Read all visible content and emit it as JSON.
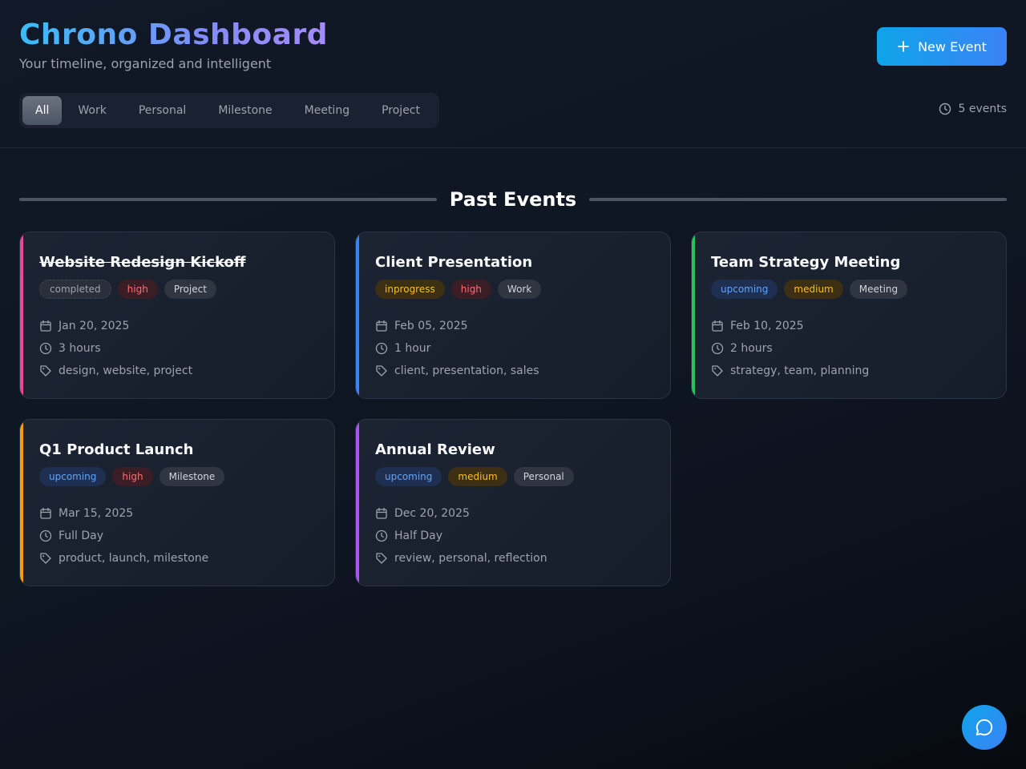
{
  "header": {
    "title": "Chrono Dashboard",
    "subtitle": "Your timeline, organized and intelligent",
    "new_event_label": "New Event",
    "event_count": "5 events"
  },
  "filters": [
    "All",
    "Work",
    "Personal",
    "Milestone",
    "Meeting",
    "Project"
  ],
  "active_filter": "All",
  "section": {
    "title": "Past Events"
  },
  "events": [
    {
      "title": "Website Redesign Kickoff",
      "status": "completed",
      "priority": "high",
      "category": "Project",
      "date": "Jan 20, 2025",
      "duration": "3 hours",
      "tags": "design, website, project",
      "accent": "#ec4899"
    },
    {
      "title": "Client Presentation",
      "status": "inprogress",
      "priority": "high",
      "category": "Work",
      "date": "Feb 05, 2025",
      "duration": "1 hour",
      "tags": "client, presentation, sales",
      "accent": "#3b82f6"
    },
    {
      "title": "Team Strategy Meeting",
      "status": "upcoming",
      "priority": "medium",
      "category": "Meeting",
      "date": "Feb 10, 2025",
      "duration": "2 hours",
      "tags": "strategy, team, planning",
      "accent": "#22c55e"
    },
    {
      "title": "Q1 Product Launch",
      "status": "upcoming",
      "priority": "high",
      "category": "Milestone",
      "date": "Mar 15, 2025",
      "duration": "Full Day",
      "tags": "product, launch, milestone",
      "accent": "#f59e0b"
    },
    {
      "title": "Annual Review",
      "status": "upcoming",
      "priority": "medium",
      "category": "Personal",
      "date": "Dec 20, 2025",
      "duration": "Half Day",
      "tags": "review, personal, reflection",
      "accent": "#a855f7"
    }
  ],
  "icons": {
    "date": "calendar-icon",
    "duration": "clock-icon",
    "tags": "tag-icon",
    "new_event": "plus-icon",
    "count": "clock-icon",
    "chat": "chat-bubble-icon"
  }
}
